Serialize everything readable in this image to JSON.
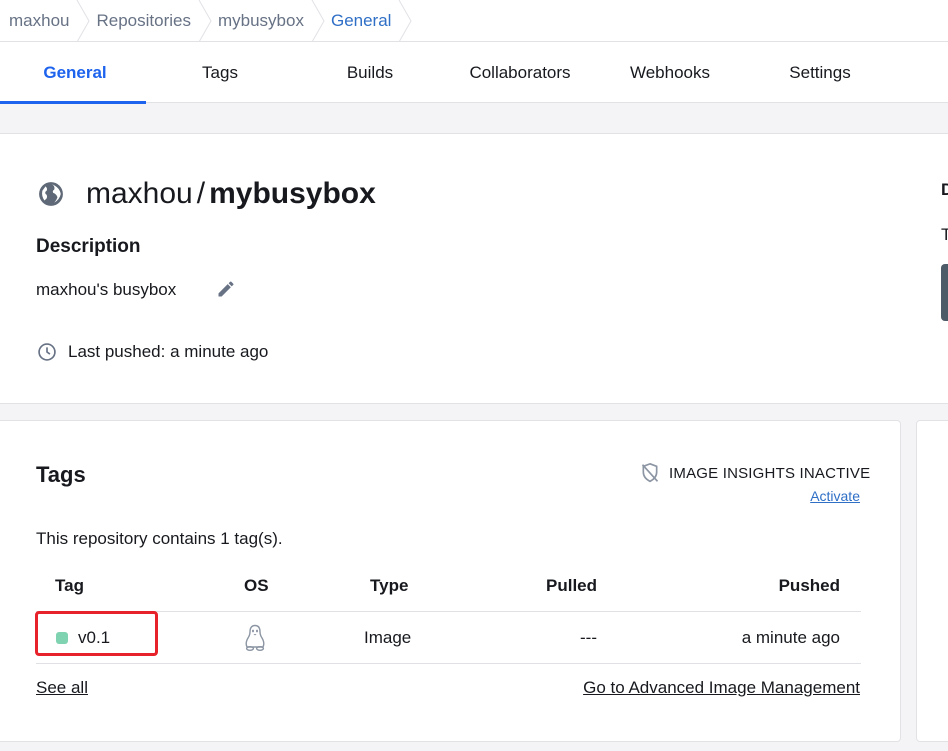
{
  "breadcrumb": {
    "items": [
      "maxhou",
      "Repositories",
      "mybusybox",
      "General"
    ]
  },
  "tabs": [
    "General",
    "Tags",
    "Builds",
    "Collaborators",
    "Webhooks",
    "Settings"
  ],
  "repo": {
    "namespace": "maxhou",
    "slash": "/",
    "name": "mybusybox",
    "description_heading": "Description",
    "description": "maxhou's busybox",
    "last_pushed": "Last pushed: a minute ago",
    "visibility_icon": "globe-icon"
  },
  "right_panel_cut": {
    "heading_fragment": "D",
    "text_fragment": "T"
  },
  "tags_section": {
    "heading": "Tags",
    "insights_status": "IMAGE INSIGHTS INACTIVE",
    "activate_label": "Activate",
    "count_text": "This repository contains 1 tag(s).",
    "columns": [
      "Tag",
      "OS",
      "Type",
      "Pulled",
      "Pushed"
    ],
    "rows": [
      {
        "tag": "v0.1",
        "os_icon": "linux-icon",
        "type": "Image",
        "pulled": "---",
        "pushed": "a minute ago"
      }
    ],
    "see_all_label": "See all",
    "advanced_label": "Go to Advanced Image Management"
  },
  "colors": {
    "accent": "#1d63ed",
    "link": "#2f6fc6",
    "tag_status": "#7fd3b1",
    "highlight": "#e8222a"
  }
}
